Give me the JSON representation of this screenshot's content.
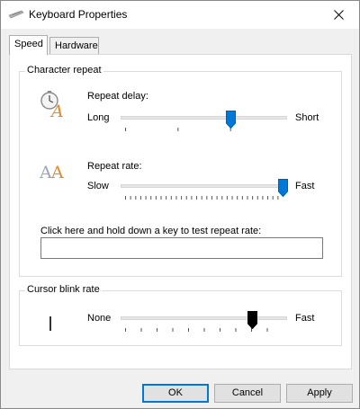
{
  "window": {
    "title": "Keyboard Properties",
    "close_symbol": "✕"
  },
  "tabs": [
    {
      "label": "Speed",
      "active": true
    },
    {
      "label": "Hardware",
      "active": false
    }
  ],
  "character_repeat": {
    "group_label": "Character repeat",
    "repeat_delay": {
      "label": "Repeat delay:",
      "min_label": "Long",
      "max_label": "Short",
      "icon": "repeat-delay-clock-icon",
      "value_fraction": 0.67,
      "tick_count": 4
    },
    "repeat_rate": {
      "label": "Repeat rate:",
      "min_label": "Slow",
      "max_label": "Fast",
      "icon": "repeat-rate-letters-icon",
      "value_fraction": 1.0,
      "tick_count": 32
    },
    "test": {
      "label": "Click here and hold down a key to test repeat rate:",
      "value": ""
    }
  },
  "cursor_blink": {
    "group_label": "Cursor blink rate",
    "min_label": "None",
    "max_label": "Fast",
    "icon": "cursor-bar-icon",
    "value_fraction": 0.81,
    "tick_count": 11
  },
  "buttons": {
    "ok": "OK",
    "cancel": "Cancel",
    "apply": "Apply"
  },
  "colors": {
    "accent": "#0078d7",
    "thumb_blue": "#0078d7",
    "thumb_black": "#000000",
    "icon_orange": "#e38a2a"
  }
}
